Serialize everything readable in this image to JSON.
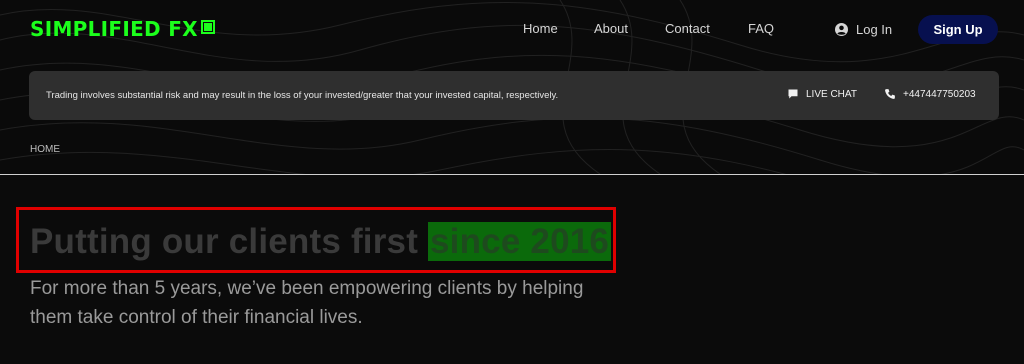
{
  "header": {
    "logo_text": "SIMPLIFIED FX",
    "nav": {
      "home": "Home",
      "about": "About",
      "contact": "Contact",
      "faq": "FAQ"
    },
    "login_label": "Log In",
    "login_icon": "user-circle-icon",
    "signup_label": "Sign Up"
  },
  "risk_bar": {
    "text": "Trading involves substantial risk and may result in the loss of your invested/greater that your invested capital, respectively.",
    "live_chat_label": "LIVE CHAT",
    "live_chat_icon": "chat-bubble-icon",
    "phone_number": "+447447750203",
    "phone_icon": "phone-icon"
  },
  "breadcrumb": {
    "home": "HOME"
  },
  "hero": {
    "title_main": "Putting our clients first ",
    "title_highlight": "since 2016",
    "subtitle": "For more than 5 years, we’ve been empowering clients by helping them take control of their financial lives."
  },
  "colors": {
    "brand_green": "#1cff1c",
    "signup_bg": "#07104f",
    "highlight_bg": "#0b6a0b",
    "annotation_red": "#e00000"
  }
}
